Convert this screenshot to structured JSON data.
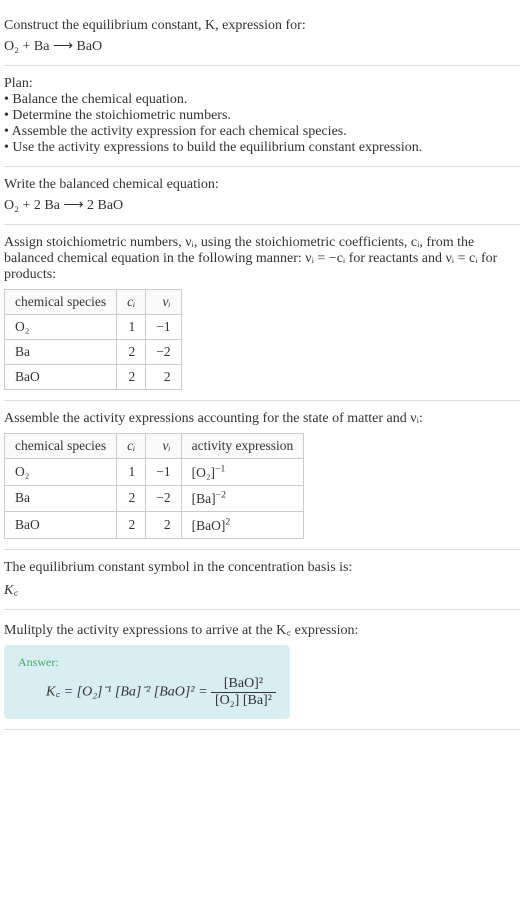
{
  "intro": {
    "line1": "Construct the equilibrium constant, K, expression for:",
    "equation": "O₂ + Ba ⟶ BaO"
  },
  "plan": {
    "heading": "Plan:",
    "b1": "• Balance the chemical equation.",
    "b2": "• Determine the stoichiometric numbers.",
    "b3": "• Assemble the activity expression for each chemical species.",
    "b4": "• Use the activity expressions to build the equilibrium constant expression."
  },
  "balanced": {
    "heading": "Write the balanced chemical equation:",
    "equation": "O₂ + 2 Ba ⟶ 2 BaO"
  },
  "stoich": {
    "text1": "Assign stoichiometric numbers, νᵢ, using the stoichiometric coefficients, cᵢ, from the balanced chemical equation in the following manner: νᵢ = −cᵢ for reactants and νᵢ = cᵢ for products:",
    "headers": {
      "h1": "chemical species",
      "h2": "cᵢ",
      "h3": "νᵢ"
    },
    "rows": [
      {
        "sp": "O₂",
        "c": "1",
        "v": "−1"
      },
      {
        "sp": "Ba",
        "c": "2",
        "v": "−2"
      },
      {
        "sp": "BaO",
        "c": "2",
        "v": "2"
      }
    ]
  },
  "activity": {
    "text": "Assemble the activity expressions accounting for the state of matter and νᵢ:",
    "headers": {
      "h1": "chemical species",
      "h2": "cᵢ",
      "h3": "νᵢ",
      "h4": "activity expression"
    },
    "rows": [
      {
        "sp": "O₂",
        "c": "1",
        "v": "−1",
        "a_base": "[O₂]",
        "a_exp": "−1"
      },
      {
        "sp": "Ba",
        "c": "2",
        "v": "−2",
        "a_base": "[Ba]",
        "a_exp": "−2"
      },
      {
        "sp": "BaO",
        "c": "2",
        "v": "2",
        "a_base": "[BaO]",
        "a_exp": "2"
      }
    ]
  },
  "symbol": {
    "text": "The equilibrium constant symbol in the concentration basis is:",
    "val": "K꜀"
  },
  "multiply": {
    "text": "Mulitply the activity expressions to arrive at the K꜀ expression:"
  },
  "answer": {
    "label": "Answer:",
    "lhs": "K꜀ = [O₂]⁻¹ [Ba]⁻² [BaO]² = ",
    "frac_num": "[BaO]²",
    "frac_den": "[O₂] [Ba]²"
  },
  "chart_data": {
    "type": "table",
    "tables": [
      {
        "title": "Stoichiometric numbers",
        "columns": [
          "chemical species",
          "c_i",
          "v_i"
        ],
        "rows": [
          [
            "O2",
            1,
            -1
          ],
          [
            "Ba",
            2,
            -2
          ],
          [
            "BaO",
            2,
            2
          ]
        ]
      },
      {
        "title": "Activity expressions",
        "columns": [
          "chemical species",
          "c_i",
          "v_i",
          "activity expression"
        ],
        "rows": [
          [
            "O2",
            1,
            -1,
            "[O2]^-1"
          ],
          [
            "Ba",
            2,
            -2,
            "[Ba]^-2"
          ],
          [
            "BaO",
            2,
            2,
            "[BaO]^2"
          ]
        ]
      }
    ]
  }
}
